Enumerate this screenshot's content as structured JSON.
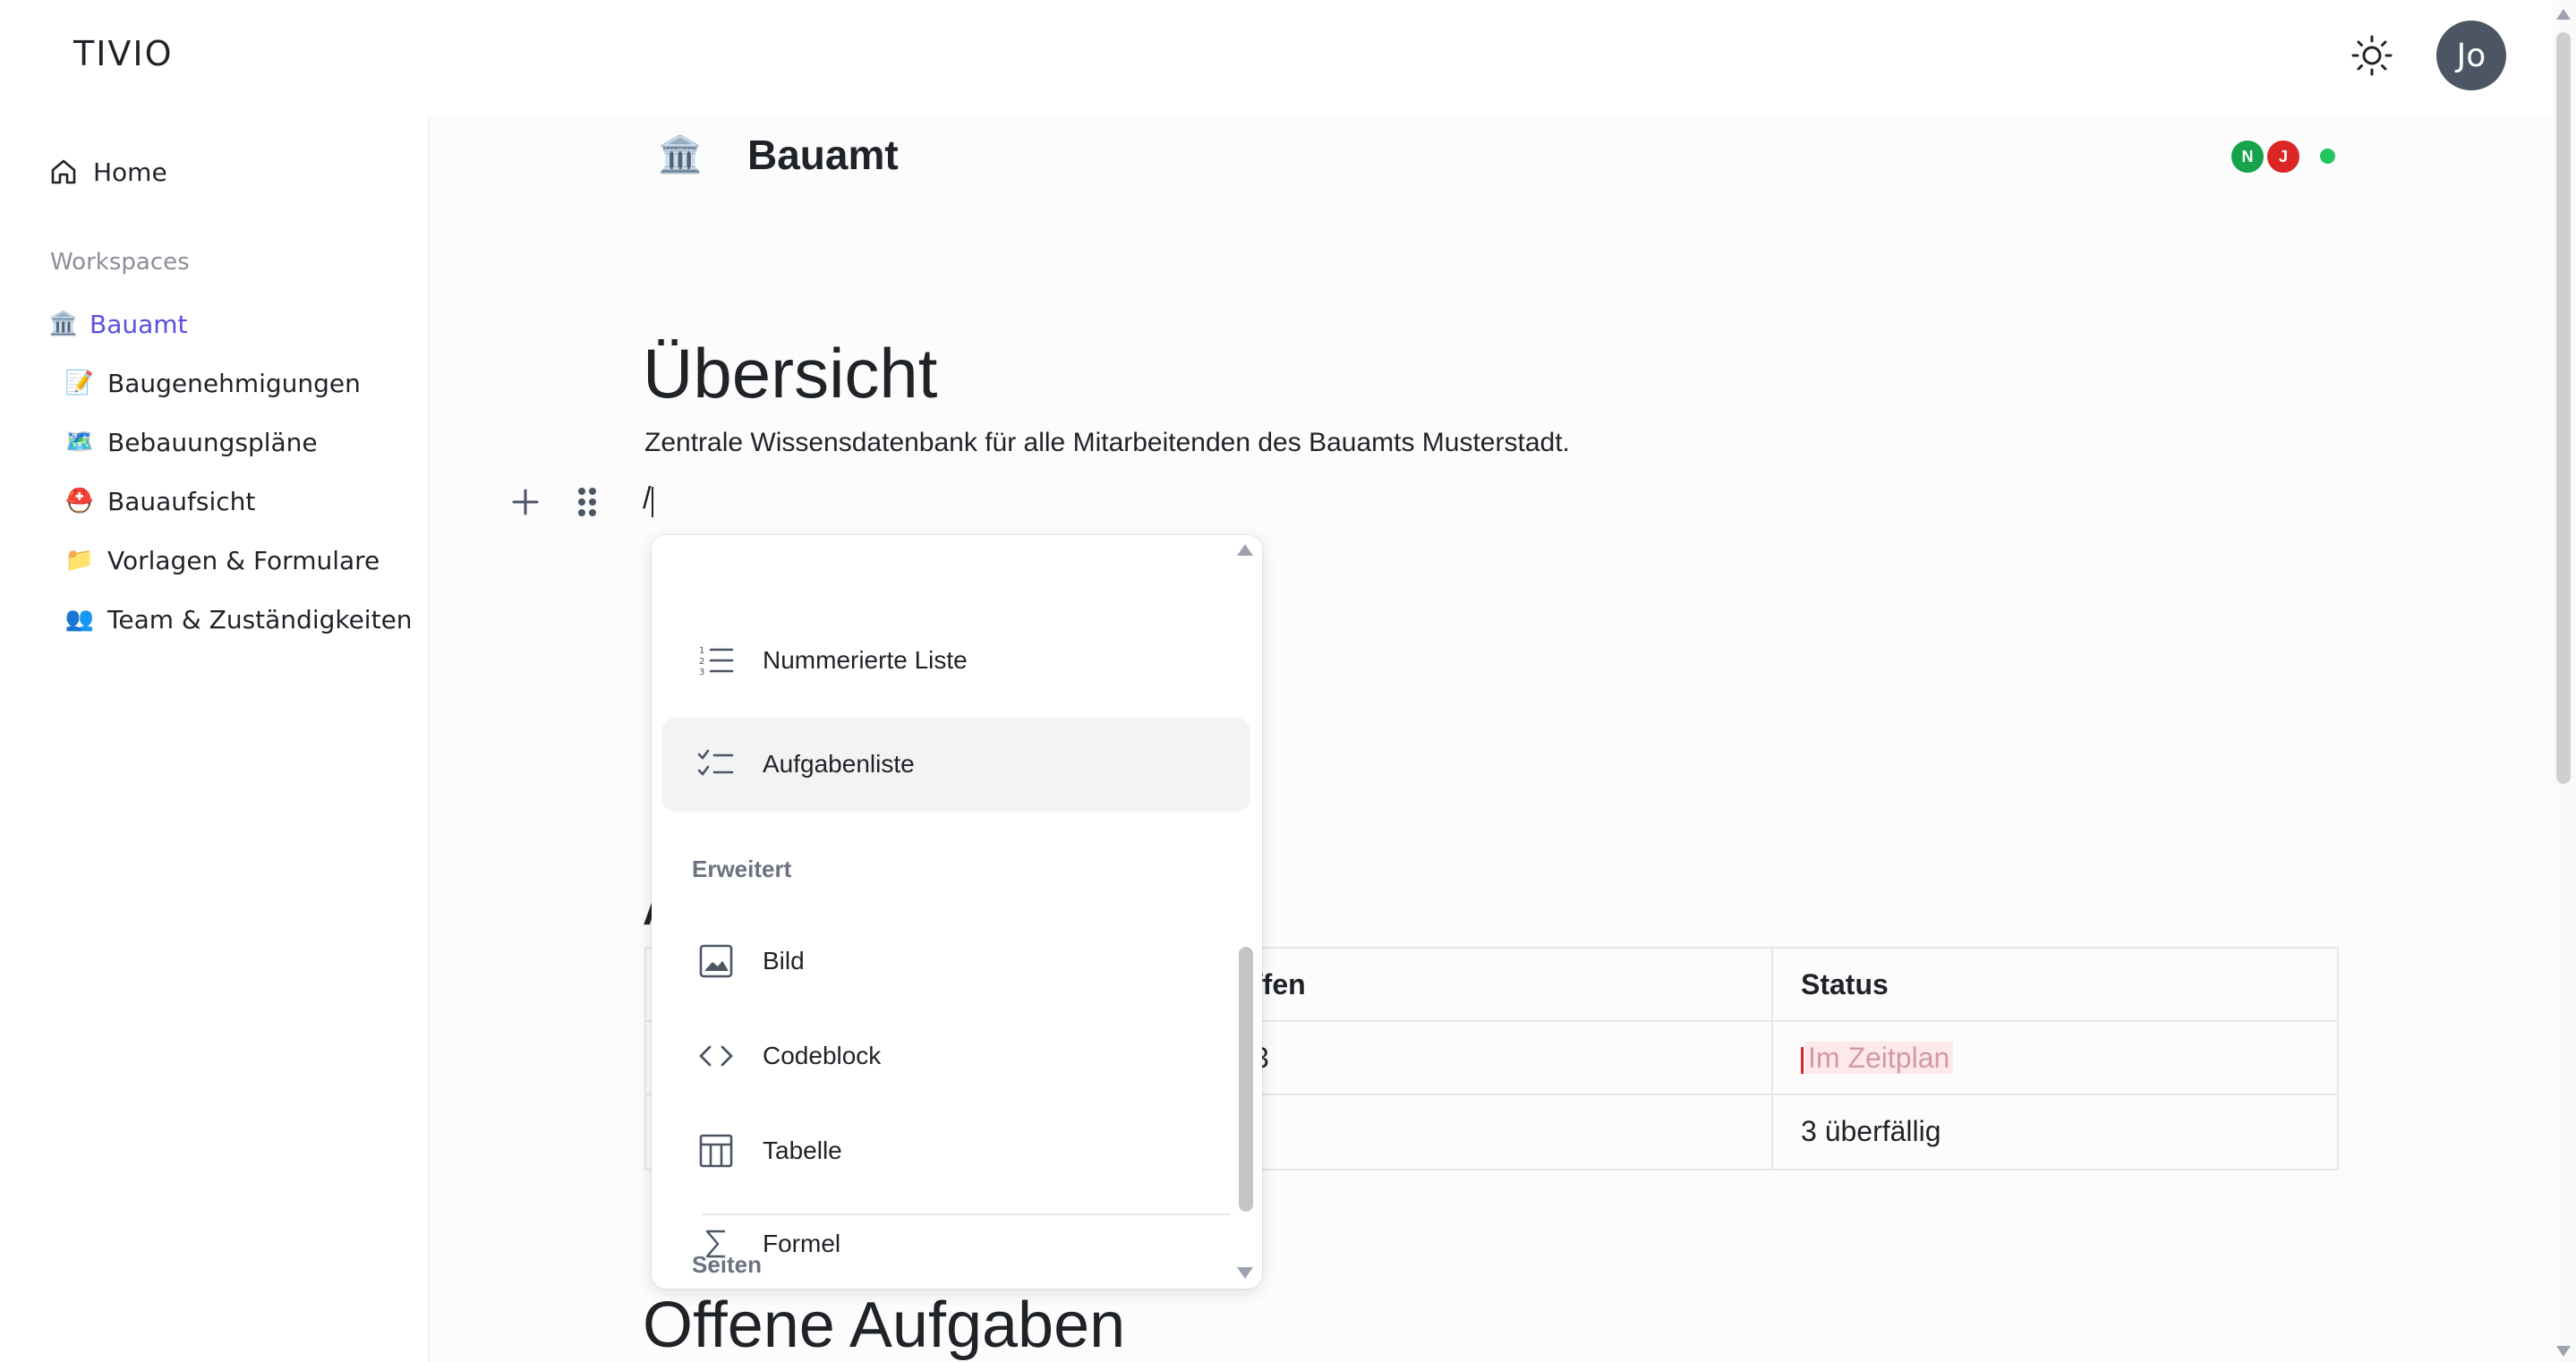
{
  "app": {
    "logo": "TIVIO",
    "user_initials": "Jo"
  },
  "sidebar": {
    "home_label": "Home",
    "section_label": "Workspaces",
    "workspace": {
      "label": "Bauamt",
      "icon": "🏛️",
      "color": "#5b4fe0"
    },
    "items": [
      {
        "label": "Baugenehmigungen",
        "icon": "📝"
      },
      {
        "label": "Bebauungspläne",
        "icon": "🗺️"
      },
      {
        "label": "Bauaufsicht",
        "icon": "⛑️"
      },
      {
        "label": "Vorlagen & Formulare",
        "icon": "📁"
      },
      {
        "label": "Team & Zuständigkeiten",
        "icon": "👥"
      }
    ]
  },
  "page": {
    "icon": "🏛️",
    "title": "Bauamt",
    "collaborators": [
      {
        "initial": "N",
        "color": "#16a34a"
      },
      {
        "initial": "J",
        "color": "#dc2626"
      }
    ],
    "online_color": "#22c55e",
    "heading": "Übersicht",
    "description": "Zentrale Wissensdatenbank für alle Mitarbeitenden des Bauamts Musterstadt.",
    "slash_input": "/",
    "partial_heading": "A",
    "table": {
      "headers": [
        "ffen",
        "Status"
      ],
      "rows": [
        [
          "3",
          "Im Zeitplan"
        ],
        [
          "",
          "3 überfällig"
        ]
      ]
    },
    "next_heading": "Offene Aufgaben"
  },
  "menu": {
    "items_top": [
      {
        "label": "Nummerierte Liste",
        "icon": "numbered-list-icon"
      },
      {
        "label": "Aufgabenliste",
        "icon": "task-list-icon",
        "selected": true
      }
    ],
    "section_extended": "Erweitert",
    "items_extended": [
      {
        "label": "Bild",
        "icon": "image-icon"
      },
      {
        "label": "Codeblock",
        "icon": "code-icon"
      },
      {
        "label": "Tabelle",
        "icon": "table-icon"
      },
      {
        "label": "Formel",
        "icon": "sigma-icon"
      }
    ],
    "section_pages": "Seiten"
  }
}
